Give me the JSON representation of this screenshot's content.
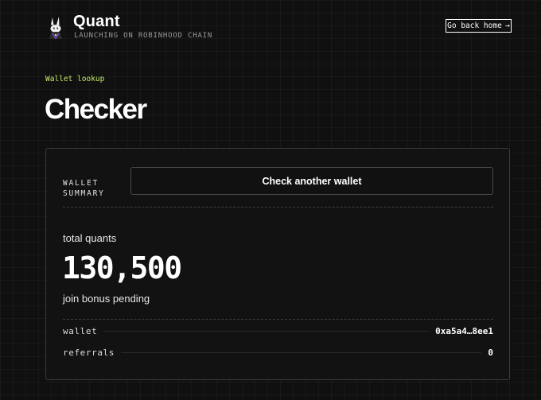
{
  "header": {
    "brand_name": "Quant",
    "tagline": "LAUNCHING ON ROBINHOOD CHAIN",
    "back_label": "Go back home",
    "back_icon": "arrow-right-icon",
    "logo_icon": "rabbit-logo-icon"
  },
  "page": {
    "eyebrow": "Wallet lookup",
    "title": "Checker"
  },
  "card": {
    "summary_label_line1": "WALLET",
    "summary_label_line2": "SUMMARY",
    "check_button_label": "Check another wallet",
    "total_label": "total quants",
    "total_value": "130,500",
    "bonus_text": "join bonus pending",
    "rows": [
      {
        "key": "wallet",
        "value": "0xa5a4…8ee1"
      },
      {
        "key": "referrals",
        "value": "0"
      }
    ]
  },
  "colors": {
    "accent": "#c6ea6b",
    "background": "#101010",
    "text": "#ffffff"
  }
}
